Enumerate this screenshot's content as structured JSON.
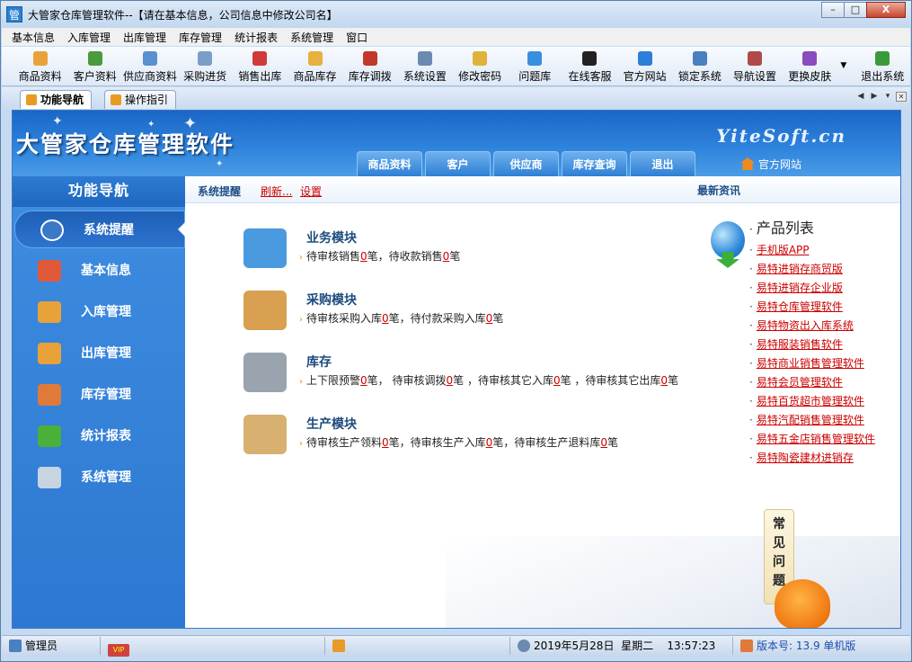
{
  "window": {
    "title": "大管家仓库管理软件--【请在基本信息，公司信息中修改公司名】",
    "app_icon_text": "管",
    "buttons": {
      "minimize": "–",
      "maximize": "□",
      "close": "X"
    }
  },
  "menu": [
    "基本信息",
    "入库管理",
    "出库管理",
    "库存管理",
    "统计报表",
    "系统管理",
    "窗口"
  ],
  "toolbar": [
    {
      "label": "商品资料",
      "icon": "goods-icon",
      "color": "#e8a23a"
    },
    {
      "label": "客户资料",
      "icon": "customer-icon",
      "color": "#4a9a3e"
    },
    {
      "label": "供应商资料",
      "icon": "supplier-icon",
      "color": "#5a8fd0"
    },
    {
      "label": "采购进货",
      "icon": "truck-icon",
      "color": "#7a9ec8"
    },
    {
      "label": "销售出库",
      "icon": "basket-icon",
      "color": "#d03a3a"
    },
    {
      "label": "商品库存",
      "icon": "box-icon",
      "color": "#e8b040"
    },
    {
      "label": "库存调拨",
      "icon": "transfer-icon",
      "color": "#c0392b"
    },
    {
      "label": "系统设置",
      "icon": "settings-icon",
      "color": "#6a8ab0"
    },
    {
      "label": "修改密码",
      "icon": "key-icon",
      "color": "#e0b23a"
    },
    {
      "label": "问题库",
      "icon": "question-icon",
      "color": "#3a8ee0"
    },
    {
      "label": "在线客服",
      "icon": "penguin-icon",
      "color": "#222222"
    },
    {
      "label": "官方网站",
      "icon": "ie-icon",
      "color": "#2b7fd6"
    },
    {
      "label": "锁定系统",
      "icon": "lock-icon",
      "color": "#4a7fc0"
    },
    {
      "label": "导航设置",
      "icon": "nav-settings-icon",
      "color": "#b04a4a"
    },
    {
      "label": "更换皮肤",
      "icon": "skin-icon",
      "color": "#8a4ac0"
    },
    {
      "label": "退出系统",
      "icon": "exit-icon",
      "color": "#3a9a3a"
    }
  ],
  "tabs": [
    {
      "label": "功能导航",
      "active": true
    },
    {
      "label": "操作指引",
      "active": false
    }
  ],
  "banner": {
    "logo": "大管家仓库管理软件",
    "site": "YiteSoft.cn",
    "nav": [
      "商品资料",
      "客户",
      "供应商",
      "库存查询",
      "退出"
    ],
    "official": "官方网站"
  },
  "sidebar": {
    "heading": "功能导航",
    "items": [
      {
        "label": "系统提醒",
        "icon": "info-icon",
        "color": "#3a78c8"
      },
      {
        "label": "基本信息",
        "icon": "cubes-icon",
        "color": "#e05a3a"
      },
      {
        "label": "入库管理",
        "icon": "inbound-box-icon",
        "color": "#e8a23a"
      },
      {
        "label": "出库管理",
        "icon": "outbound-box-icon",
        "color": "#e8a23a"
      },
      {
        "label": "库存管理",
        "icon": "warehouse-icon",
        "color": "#e07a3a"
      },
      {
        "label": "统计报表",
        "icon": "bar-chart-icon",
        "color": "#4ab03a"
      },
      {
        "label": "系统管理",
        "icon": "tools-icon",
        "color": "#c8d4e0"
      }
    ]
  },
  "content": {
    "heading": "系统提醒",
    "refresh": "刷新...",
    "settings": "设置",
    "news": "最新资讯",
    "modules": [
      {
        "title": "业务模块",
        "icon": "folder-icon",
        "color": "#4a9ae0",
        "parts": [
          "待审核销售",
          "0",
          "笔，待收款销售",
          "0",
          "笔"
        ]
      },
      {
        "title": "采购模块",
        "icon": "purchase-box-icon",
        "color": "#d8a050",
        "parts": [
          "待审核采购入库",
          "0",
          "笔，待付款采购入库",
          "0",
          "笔"
        ]
      },
      {
        "title": "库存",
        "icon": "database-icon",
        "color": "#9aa4ae",
        "parts": [
          "上下限预警",
          "0",
          "笔，  待审核调拨",
          "0",
          "笔 ，待审核其它入库",
          "0",
          "笔 ，待审核其它出库",
          "0",
          "笔"
        ]
      },
      {
        "title": "生产模块",
        "icon": "clipboard-icon",
        "color": "#d8b070",
        "parts": [
          "待审核生产领料",
          "0",
          "笔，待审核生产入库",
          "0",
          "笔，待审核生产退料库",
          "0",
          "笔"
        ]
      }
    ],
    "products": {
      "title": "产品列表",
      "items": [
        "手机版APP",
        "易特进销存商贸版",
        "易特进销存企业版",
        "易特仓库管理软件",
        "易特物资出入库系统",
        "易特服装销售软件",
        "易特商业销售管理软件",
        "易特会员管理软件",
        "易特百货超市管理软件",
        "易特汽配销售管理软件",
        "易特五金店销售管理软件",
        "易特陶瓷建材进销存"
      ]
    },
    "faq": [
      "常",
      "见",
      "问",
      "题"
    ]
  },
  "status": {
    "user": "管理员",
    "vip": "VIP",
    "date": "2019年5月28日",
    "weekday": "星期二",
    "time": "13:57:23",
    "version": "版本号: 13.9 单机版"
  }
}
